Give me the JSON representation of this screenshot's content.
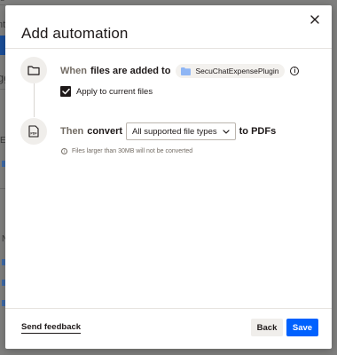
{
  "background": {
    "fragments": [
      "u",
      "nt",
      "gg",
      "Ex",
      "N"
    ]
  },
  "modal": {
    "title": "Add automation",
    "step_when": {
      "prefix": "When",
      "text": "files are added to",
      "folder_name": "SecuChatExpensePlugin",
      "info_icon": "info-icon",
      "checkbox_label": "Apply to current files",
      "checkbox_checked": true
    },
    "step_then": {
      "prefix": "Then",
      "action": "convert",
      "selected_option": "All supported file types",
      "suffix": "to PDFs",
      "note": "Files larger than 30MB will not be converted"
    },
    "footer": {
      "feedback_label": "Send feedback",
      "back_label": "Back",
      "save_label": "Save"
    }
  },
  "colors": {
    "accent": "#0061fe",
    "text": "#1e1919",
    "muted": "#736c64",
    "secondary_button": "#f0eeeb",
    "folder_icon": "#8fb6f5"
  }
}
